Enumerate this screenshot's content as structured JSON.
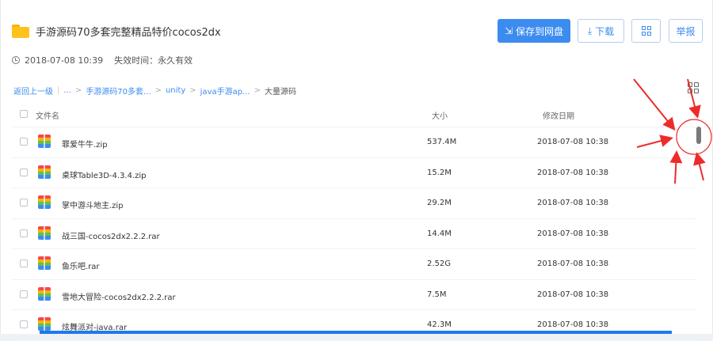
{
  "header": {
    "title": "手游源码70多套完整精品特价cocos2dx",
    "icon": "folder-icon",
    "folder_color": "#ffc21c"
  },
  "meta": {
    "created": "2018-07-08 10:39",
    "expiry": "失效时间：永久有效"
  },
  "toolbar": {
    "save_label": "保存到网盘",
    "download_label": "下载",
    "report_label": "举报",
    "accent_color": "#3c8cf0"
  },
  "breadcrumb": {
    "back": "返回上一级",
    "ellipsis": "...",
    "items": [
      "手游源码70多套...",
      "unity",
      "java手游ap..."
    ],
    "current": "大量源码"
  },
  "table": {
    "columns": {
      "name": "文件名",
      "size": "大小",
      "date": "修改日期"
    },
    "rows": [
      {
        "name": "罪爱牛牛.zip",
        "size": "537.4M",
        "date": "2018-07-08 10:38"
      },
      {
        "name": "桌球Table3D-4.3.4.zip",
        "size": "15.2M",
        "date": "2018-07-08 10:38"
      },
      {
        "name": "掌中游斗地主.zip",
        "size": "29.2M",
        "date": "2018-07-08 10:38"
      },
      {
        "name": "战三国-cocos2dx2.2.2.rar",
        "size": "14.4M",
        "date": "2018-07-08 10:38"
      },
      {
        "name": "鱼乐吧.rar",
        "size": "2.52G",
        "date": "2018-07-08 10:38"
      },
      {
        "name": "雪地大冒险-cocos2dx2.2.2.rar",
        "size": "7.5M",
        "date": "2018-07-08 10:38"
      },
      {
        "name": "炫舞派对-java.rar",
        "size": "42.3M",
        "date": "2018-07-08 10:38"
      }
    ]
  },
  "annotation_color": "#ee2b2b"
}
